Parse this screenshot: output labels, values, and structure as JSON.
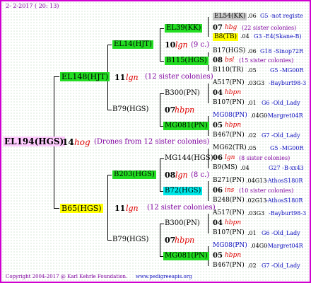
{
  "header": {
    "date": "2- 2-2017 ( 20: 13)"
  },
  "footer": {
    "copyright": "Copyright 2004-2017 @ Karl Kehrle Foundation.",
    "url": "www.pedigreeapis.org"
  },
  "root": {
    "id": "EL194(HGS)",
    "gen": "14",
    "mark": "hog",
    "note": "(Drones from 12 sister colonies)"
  },
  "upper": {
    "id": "EL148(HJT)",
    "gen": "11",
    "mark": "lgn",
    "note": "(12 sister colonies)",
    "a": {
      "id": "EL14(HJT)",
      "gen": "10",
      "mark": "lgn",
      "note": "(9 c.)",
      "a": {
        "id": "EL39(KK)",
        "gen": "07",
        "mark": "hbg",
        "note": "(22 sister colonies)",
        "a": {
          "id": "EL54(KK)",
          "val": ".06",
          "note": "G5 -not registe"
        },
        "b": {
          "id": "B8(TB)",
          "val": ".04",
          "note": "G3 -E4(Skane-B)"
        }
      },
      "b": {
        "id": "B115(HGS)",
        "gen": "08",
        "mark": "bsl",
        "note": "(15 sister colonies)",
        "a": {
          "id": "B17(HGS)",
          "val": ".06",
          "note": "G18 -Sinop72R"
        },
        "b": {
          "id": "B110(TR)",
          "val": ".05",
          "note": "G5 -MG00R"
        }
      }
    },
    "b": {
      "id": "B79(HGS)",
      "gen": "07",
      "mark": "hbpn",
      "a": {
        "id": "B300(PN)",
        "gen": "04",
        "mark": "hbpn",
        "a": {
          "id": "A517(PN)",
          "val": ".03G3",
          "note": "-Bayburt98-3"
        },
        "b": {
          "id": "B107(PN)",
          "val": ".01",
          "note": "G6 -Old_Lady"
        }
      },
      "b": {
        "id": "MG081(PN)",
        "gen": "05",
        "mark": "hbpn",
        "a": {
          "id": "MG08(PN)",
          "val": ".04G0",
          "note": "-Margret04R"
        },
        "b": {
          "id": "B467(PN)",
          "val": ".02",
          "note": "G7 -Old_Lady"
        }
      }
    }
  },
  "lower": {
    "id": "B65(HGS)",
    "gen": "11",
    "mark": "lgn",
    "note": "(12 sister colonies)",
    "a": {
      "id": "B203(HGS)",
      "gen": "08",
      "mark": "lgn",
      "note": "(8 c.)",
      "a": {
        "id": "MG144(HGS)",
        "gen": "06",
        "mark": "lgn",
        "note": "(8 sister colonies)",
        "a": {
          "id": "MG62(TR)",
          "val": ".05",
          "note": "G5 -MG00R"
        },
        "b": {
          "id": "B9(MS)",
          "val": ".04",
          "note": "G27 -B-xx43"
        }
      },
      "b": {
        "id": "B72(HGS)",
        "gen": "06",
        "mark": "ins",
        "note": "(10 sister colonies)",
        "a": {
          "id": "B271(PN)",
          "val": ".04G13",
          "note": "-AthosS180R"
        },
        "b": {
          "id": "B248(PN)",
          "val": ".02G13",
          "note": "-AthosS180R"
        }
      }
    },
    "b": {
      "id": "B79(HGS)",
      "gen": "07",
      "mark": "hbpn",
      "a": {
        "id": "B300(PN)",
        "gen": "04",
        "mark": "hbpn",
        "a": {
          "id": "A517(PN)",
          "val": ".03G3",
          "note": "-Bayburt98-3"
        },
        "b": {
          "id": "B107(PN)",
          "val": ".01",
          "note": "G6 -Old_Lady"
        }
      },
      "b": {
        "id": "MG081(PN)",
        "gen": "05",
        "mark": "hbpn",
        "a": {
          "id": "MG08(PN)",
          "val": ".04G0",
          "note": "-Margret04R"
        },
        "b": {
          "id": "B467(PN)",
          "val": ".02",
          "note": "G7 -Old_Lady"
        }
      }
    }
  }
}
